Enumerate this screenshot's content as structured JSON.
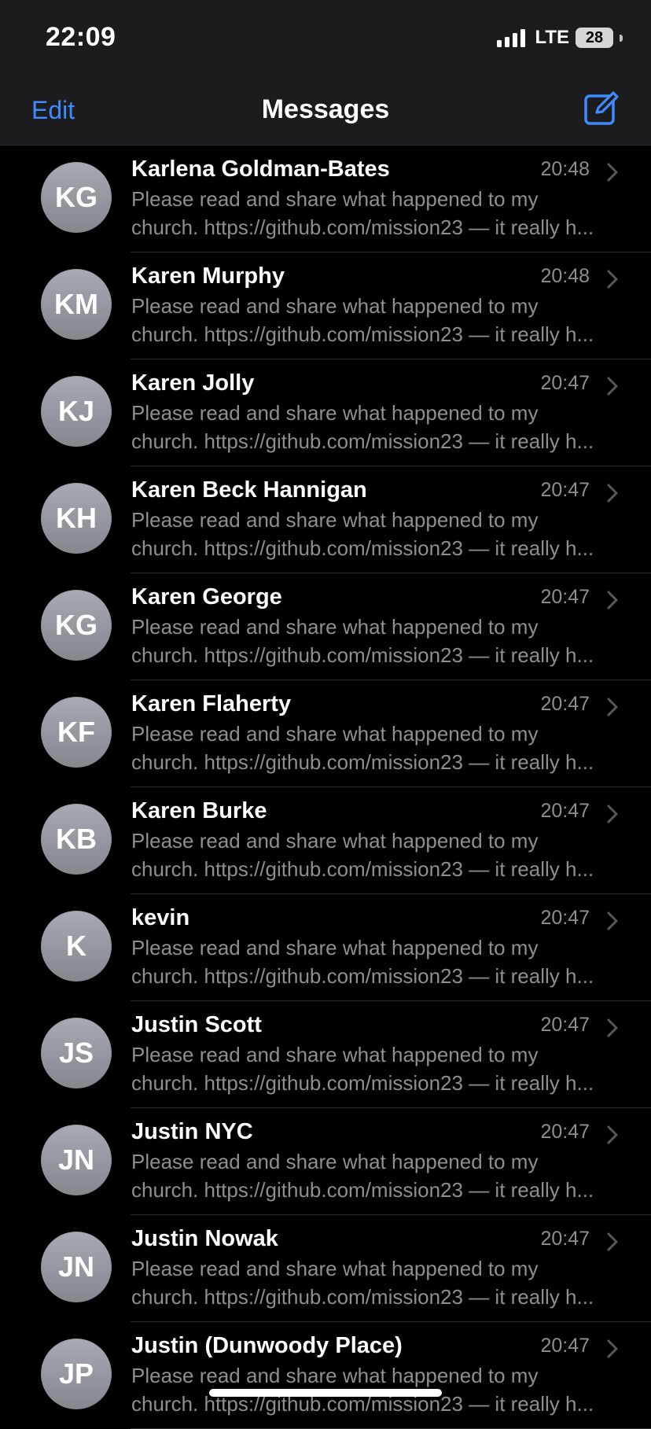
{
  "status_bar": {
    "time": "22:09",
    "network": "LTE",
    "battery": "28"
  },
  "nav": {
    "edit_label": "Edit",
    "title": "Messages"
  },
  "colors": {
    "accent": "#3c8cff",
    "background": "#000000",
    "secondary_text": "#8e8e93"
  },
  "conversations": [
    {
      "initials": "KG",
      "name": "Karlena Goldman-Bates",
      "time": "20:48",
      "preview_line1": "Please read and share what happened to my",
      "preview_line2": "church. https://github.com/mission23 — it really h..."
    },
    {
      "initials": "KM",
      "name": "Karen Murphy",
      "time": "20:48",
      "preview_line1": "Please read and share what happened to my",
      "preview_line2": "church. https://github.com/mission23 — it really h..."
    },
    {
      "initials": "KJ",
      "name": "Karen Jolly",
      "time": "20:47",
      "preview_line1": "Please read and share what happened to my",
      "preview_line2": "church. https://github.com/mission23 — it really h..."
    },
    {
      "initials": "KH",
      "name": "Karen Beck Hannigan",
      "time": "20:47",
      "preview_line1": "Please read and share what happened to my",
      "preview_line2": "church. https://github.com/mission23 — it really h..."
    },
    {
      "initials": "KG",
      "name": "Karen George",
      "time": "20:47",
      "preview_line1": "Please read and share what happened to my",
      "preview_line2": "church. https://github.com/mission23 — it really h..."
    },
    {
      "initials": "KF",
      "name": "Karen Flaherty",
      "time": "20:47",
      "preview_line1": "Please read and share what happened to my",
      "preview_line2": "church. https://github.com/mission23 — it really h..."
    },
    {
      "initials": "KB",
      "name": "Karen Burke",
      "time": "20:47",
      "preview_line1": "Please read and share what happened to my",
      "preview_line2": "church. https://github.com/mission23 — it really h..."
    },
    {
      "initials": "K",
      "name": "kevin",
      "time": "20:47",
      "preview_line1": "Please read and share what happened to my",
      "preview_line2": "church. https://github.com/mission23 — it really h..."
    },
    {
      "initials": "JS",
      "name": "Justin Scott",
      "time": "20:47",
      "preview_line1": "Please read and share what happened to my",
      "preview_line2": "church. https://github.com/mission23 — it really h..."
    },
    {
      "initials": "JN",
      "name": "Justin NYC",
      "time": "20:47",
      "preview_line1": "Please read and share what happened to my",
      "preview_line2": "church. https://github.com/mission23 — it really h..."
    },
    {
      "initials": "JN",
      "name": "Justin Nowak",
      "time": "20:47",
      "preview_line1": "Please read and share what happened to my",
      "preview_line2": "church. https://github.com/mission23 — it really h..."
    },
    {
      "initials": "JP",
      "name": "Justin (Dunwoody Place)",
      "time": "20:47",
      "preview_line1": "Please read and share what happened to my",
      "preview_line2": "church. https://github.com/mission23 — it really h..."
    }
  ]
}
